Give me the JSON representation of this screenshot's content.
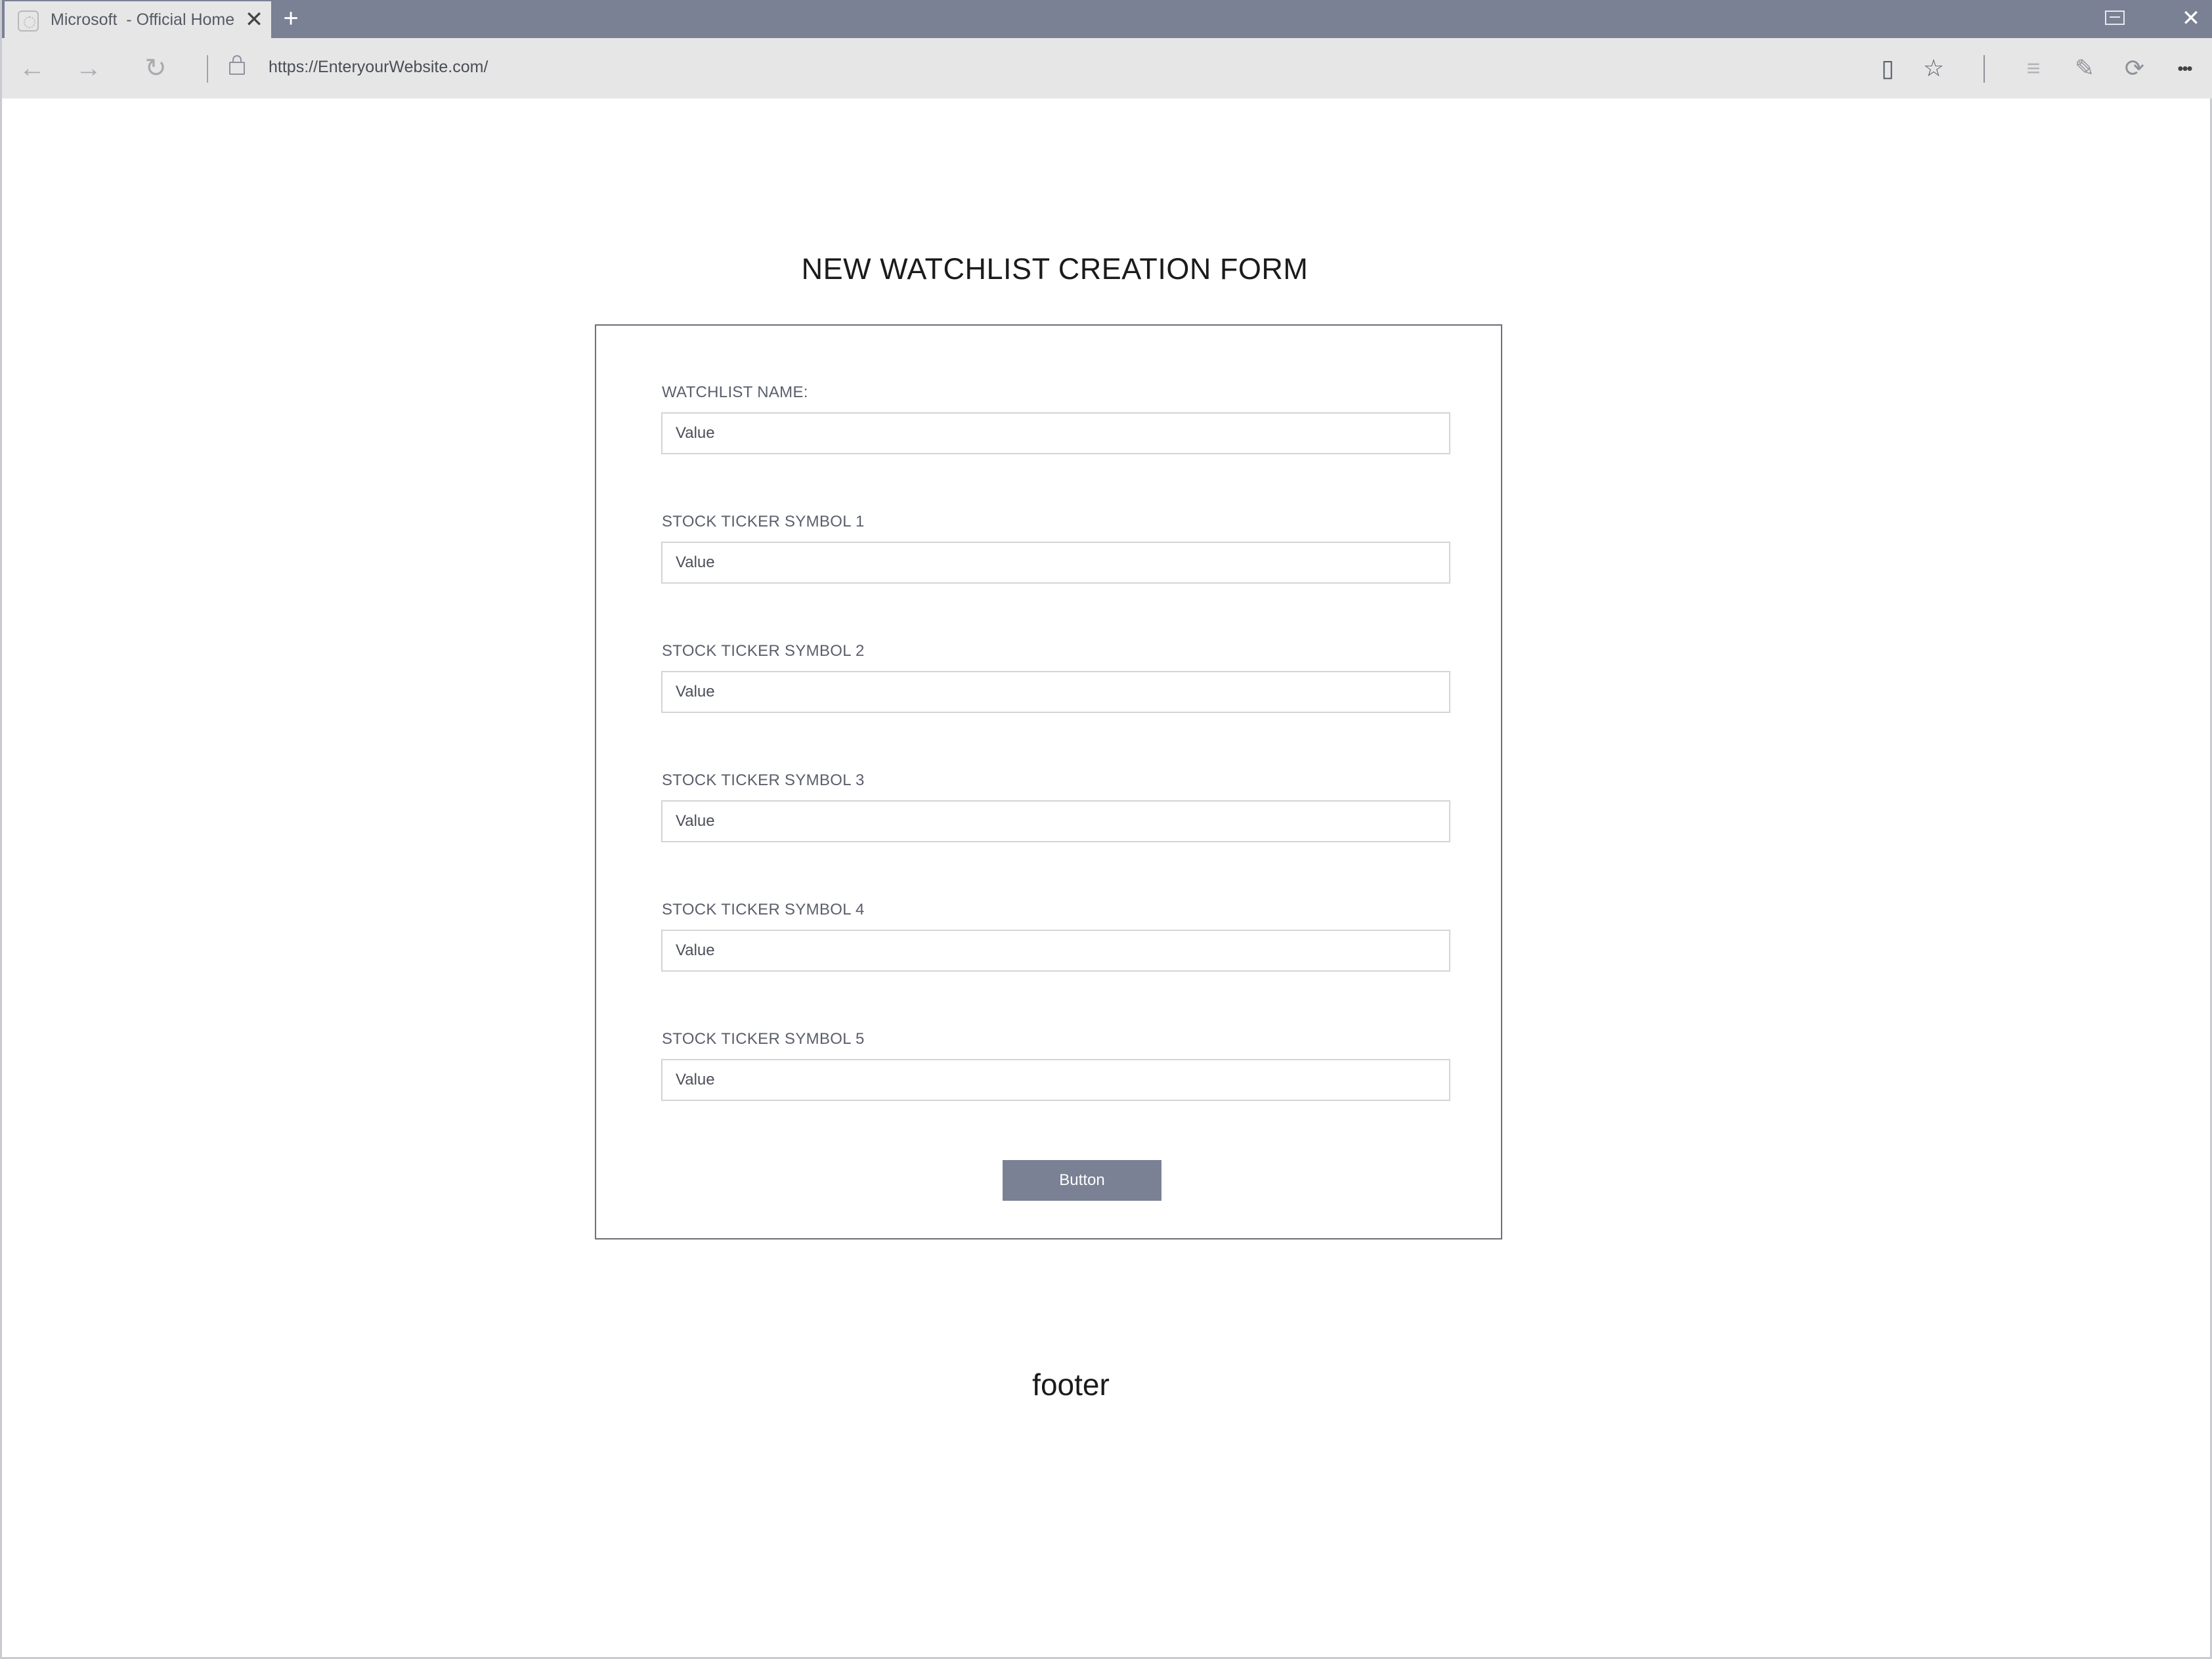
{
  "browser": {
    "tab": {
      "title": "Microsoft  - Official Home",
      "close_glyph": "✕"
    },
    "new_tab_glyph": "+",
    "window_close_glyph": "✕",
    "nav": {
      "back_glyph": "←",
      "forward_glyph": "→",
      "refresh_glyph": "↻"
    },
    "url": "https://EnteryourWebsite.com/",
    "tools": {
      "reading_view_glyph": "▯",
      "favorite_glyph": "☆",
      "hub_glyph": "≡",
      "web_note_glyph": "✎",
      "share_glyph": "⟳",
      "more_glyph": "•••"
    }
  },
  "page": {
    "title": "NEW WATCHLIST CREATION FORM",
    "fields": [
      {
        "label": "WATCHLIST NAME:",
        "placeholder": "Value"
      },
      {
        "label": "STOCK TICKER SYMBOL 1",
        "placeholder": "Value"
      },
      {
        "label": "STOCK TICKER SYMBOL 2",
        "placeholder": "Value"
      },
      {
        "label": "STOCK TICKER SYMBOL 3",
        "placeholder": "Value"
      },
      {
        "label": "STOCK TICKER SYMBOL 4",
        "placeholder": "Value"
      },
      {
        "label": "STOCK TICKER SYMBOL 5",
        "placeholder": "Value"
      }
    ],
    "submit_label": "Button",
    "footer": "footer"
  },
  "colors": {
    "accent": "#7a8194",
    "chrome_background": "#e6e6e6",
    "input_border": "#d3d4d8",
    "form_border": "#6d6f75"
  }
}
